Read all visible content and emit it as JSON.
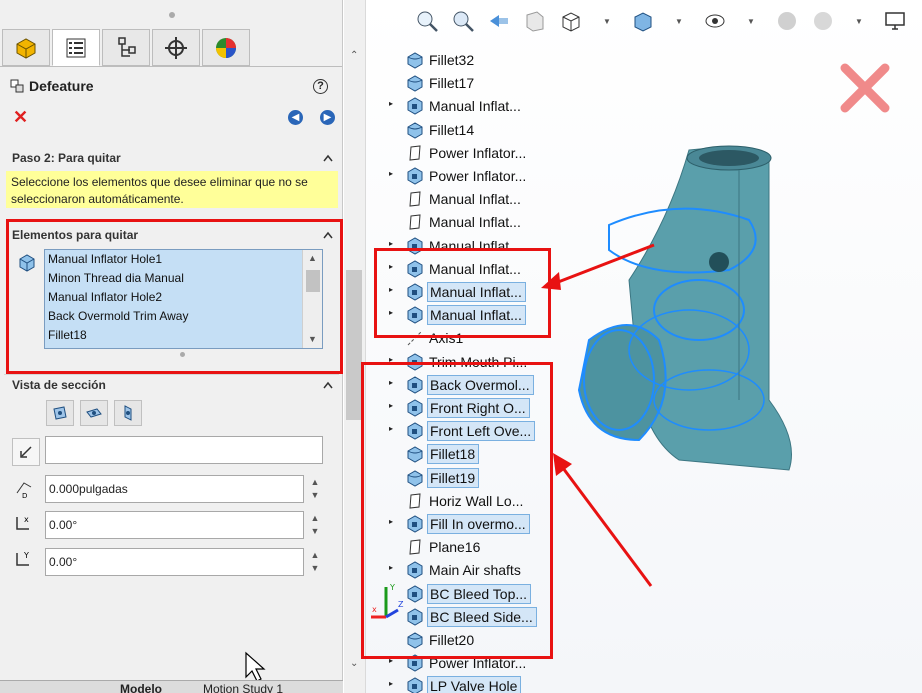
{
  "property_manager": {
    "title": "Defeature",
    "step_header": "Paso 2: Para quitar",
    "message": "Seleccione los elementos que desee eliminar que no se seleccionaron automáticamente.",
    "remove_section": {
      "header": "Elementos para quitar",
      "items": [
        "Manual Inflator Hole1",
        "Minon Thread dia Manual",
        "Manual Inflator Hole2",
        "Back Overmold Trim Away",
        "Fillet18"
      ]
    },
    "section_view": {
      "header": "Vista de sección",
      "distance": "0.000pulgadas",
      "angle_x": "0.00°",
      "angle_y": "0.00°"
    },
    "bottom_tabs": [
      "Modelo",
      "Motion Study 1"
    ]
  },
  "tree": [
    {
      "label": "Fillet32",
      "icon": "fillet",
      "expand": false,
      "selected": false
    },
    {
      "label": "Fillet17",
      "icon": "fillet",
      "expand": false,
      "selected": false
    },
    {
      "label": "Manual Inflat...",
      "icon": "cut",
      "expand": true,
      "selected": false
    },
    {
      "label": "Fillet14",
      "icon": "fillet",
      "expand": false,
      "selected": false
    },
    {
      "label": "Power Inflator...",
      "icon": "plane",
      "expand": false,
      "selected": false
    },
    {
      "label": "Power Inflator...",
      "icon": "cut",
      "expand": true,
      "selected": false
    },
    {
      "label": "Manual Inflat...",
      "icon": "plane",
      "expand": false,
      "selected": false
    },
    {
      "label": "Manual Inflat...",
      "icon": "plane",
      "expand": false,
      "selected": false
    },
    {
      "label": "Manual Inflat...",
      "icon": "cut",
      "expand": true,
      "selected": false
    },
    {
      "label": "Manual Inflat...",
      "icon": "cut",
      "expand": true,
      "selected": false
    },
    {
      "label": "Manual Inflat...",
      "icon": "cut",
      "expand": true,
      "selected": true
    },
    {
      "label": "Manual Inflat...",
      "icon": "cut",
      "expand": true,
      "selected": true
    },
    {
      "label": "Axis1",
      "icon": "axis",
      "expand": false,
      "selected": false
    },
    {
      "label": "Trim Mouth Pi...",
      "icon": "cut",
      "expand": true,
      "selected": false
    },
    {
      "label": "Back Overmol...",
      "icon": "cut",
      "expand": true,
      "selected": true
    },
    {
      "label": "Front Right O...",
      "icon": "cut",
      "expand": true,
      "selected": true
    },
    {
      "label": "Front Left Ove...",
      "icon": "cut",
      "expand": true,
      "selected": true
    },
    {
      "label": "Fillet18",
      "icon": "fillet",
      "expand": false,
      "selected": true
    },
    {
      "label": "Fillet19",
      "icon": "fillet",
      "expand": false,
      "selected": true
    },
    {
      "label": "Horiz Wall Lo...",
      "icon": "plane",
      "expand": false,
      "selected": false
    },
    {
      "label": "Fill In overmo...",
      "icon": "cut",
      "expand": true,
      "selected": true
    },
    {
      "label": "Plane16",
      "icon": "plane",
      "expand": false,
      "selected": false
    },
    {
      "label": "Main Air shafts",
      "icon": "cut",
      "expand": true,
      "selected": false
    },
    {
      "label": "BC Bleed Top...",
      "icon": "cut",
      "expand": false,
      "selected": true
    },
    {
      "label": "BC Bleed Side...",
      "icon": "cut",
      "expand": false,
      "selected": true
    },
    {
      "label": "Fillet20",
      "icon": "fillet",
      "expand": false,
      "selected": false
    },
    {
      "label": "Power Inflator...",
      "icon": "cut",
      "expand": true,
      "selected": false
    },
    {
      "label": "LP Valve Hole",
      "icon": "cut",
      "expand": true,
      "selected": true
    }
  ],
  "colors": {
    "highlight_red": "#e81212",
    "selection_blue": "#d4e6f7",
    "model_teal": "#5a9fab",
    "wire_blue": "#1e8cff"
  }
}
